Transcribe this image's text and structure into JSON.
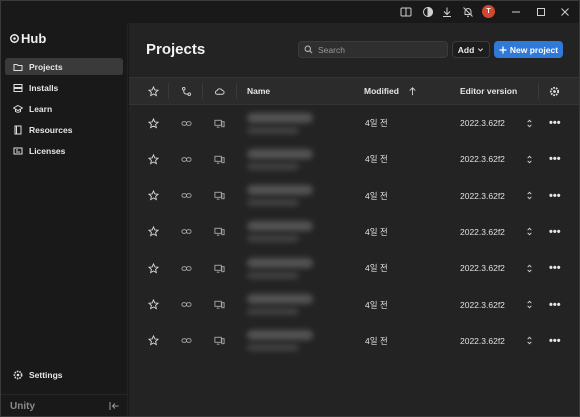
{
  "titlebar": {
    "icons": [
      "manual-icon",
      "theme-icon",
      "download-icon",
      "bell-off-icon"
    ],
    "avatar_initial": "T",
    "window_controls": [
      "minimize-icon",
      "maximize-icon",
      "close-icon"
    ]
  },
  "sidebar": {
    "brand": "Hub",
    "items": [
      {
        "label": "Projects",
        "icon": "folder-icon",
        "active": true
      },
      {
        "label": "Installs",
        "icon": "installs-icon",
        "active": false
      },
      {
        "label": "Learn",
        "icon": "graduation-cap-icon",
        "active": false
      },
      {
        "label": "Resources",
        "icon": "book-icon",
        "active": false
      },
      {
        "label": "Licenses",
        "icon": "license-icon",
        "active": false
      }
    ],
    "settings_label": "Settings",
    "footer_logo": "Unity",
    "collapse_icon": "collapse-sidebar-icon"
  },
  "main": {
    "title": "Projects",
    "search_placeholder": "Search",
    "add_label": "Add",
    "new_project_label": "New project",
    "accent": "#2f79d9"
  },
  "table": {
    "headers": {
      "favorite_icon": "star-icon",
      "vcs_icon": "branch-icon",
      "cloud_icon": "cloud-icon",
      "name": "Name",
      "modified": "Modified",
      "modified_sort": "arrow-up-icon",
      "editor_version": "Editor version",
      "settings_icon": "gear-icon"
    },
    "rows": [
      {
        "modified": "4일 전",
        "version": "2022.3.62f2"
      },
      {
        "modified": "4일 전",
        "version": "2022.3.62f2"
      },
      {
        "modified": "4일 전",
        "version": "2022.3.62f2"
      },
      {
        "modified": "4일 전",
        "version": "2022.3.62f2"
      },
      {
        "modified": "4일 전",
        "version": "2022.3.62f2"
      },
      {
        "modified": "4일 전",
        "version": "2022.3.62f2"
      },
      {
        "modified": "4일 전",
        "version": "2022.3.62f2"
      }
    ],
    "more_label": "•••"
  }
}
